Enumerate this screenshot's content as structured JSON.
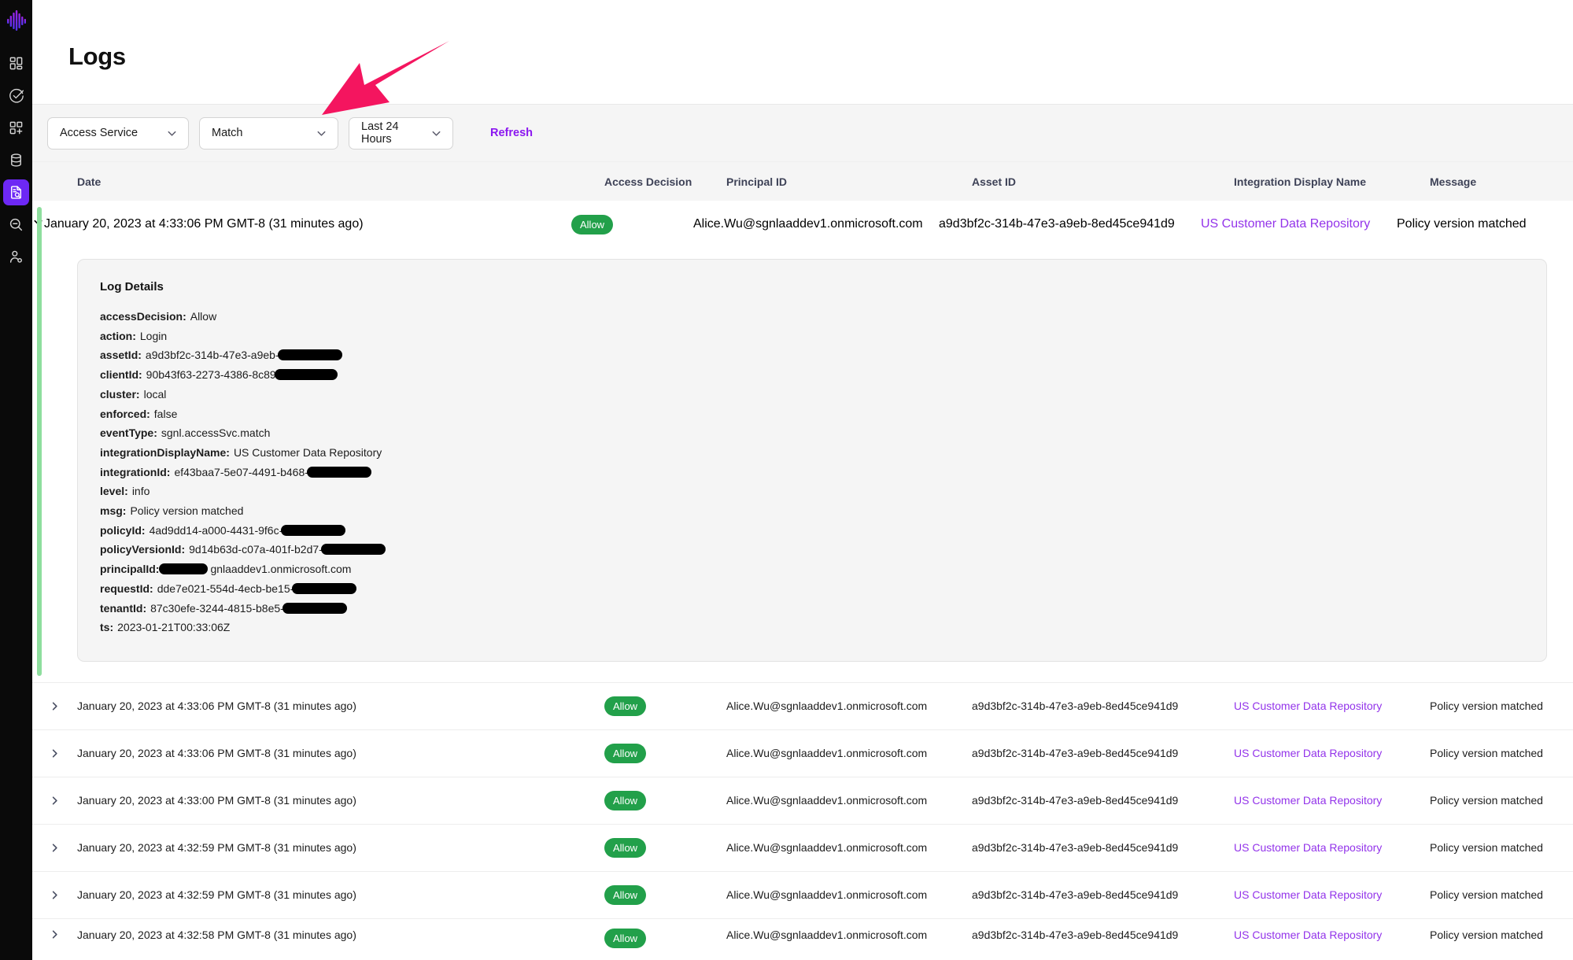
{
  "sidebar": {
    "logo_name": "waveform-logo",
    "items": [
      {
        "icon": "dashboard-grid-icon",
        "name": "sidebar-item-dashboard",
        "active": false
      },
      {
        "icon": "check-circle-icon",
        "name": "sidebar-item-policies",
        "active": false
      },
      {
        "icon": "add-grid-icon",
        "name": "sidebar-item-integrations",
        "active": false
      },
      {
        "icon": "database-icon",
        "name": "sidebar-item-datasources",
        "active": false
      },
      {
        "icon": "document-search-icon",
        "name": "sidebar-item-logs",
        "active": true
      },
      {
        "icon": "zoom-out-icon",
        "name": "sidebar-item-search",
        "active": false
      },
      {
        "icon": "user-settings-icon",
        "name": "sidebar-item-users",
        "active": false
      }
    ],
    "active_color": "#6d28f5"
  },
  "header": {
    "title": "Logs"
  },
  "filters": {
    "service": {
      "label": "Access Service"
    },
    "match": {
      "label": "Match"
    },
    "time_range": {
      "label": "Last 24 Hours"
    },
    "refresh_label": "Refresh",
    "refresh_color": "#8b16f0"
  },
  "table": {
    "columns": [
      {
        "key": "date",
        "label": "Date"
      },
      {
        "key": "access_decision",
        "label": "Access Decision"
      },
      {
        "key": "principal_id",
        "label": "Principal ID"
      },
      {
        "key": "asset_id",
        "label": "Asset ID"
      },
      {
        "key": "integration_display_name",
        "label": "Integration Display Name"
      },
      {
        "key": "message",
        "label": "Message"
      }
    ],
    "rows": [
      {
        "date": "January 20, 2023 at 4:33:06 PM GMT-8 (31 minutes ago)",
        "access_decision": "Allow",
        "principal_id": "Alice.Wu@sgnlaaddev1.onmicrosoft.com",
        "asset_id": "a9d3bf2c-314b-47e3-a9eb-8ed45ce941d9",
        "integration_display_name": "US Customer Data Repository",
        "message": "Policy version matched",
        "expanded": true
      },
      {
        "date": "January 20, 2023 at 4:33:06 PM GMT-8 (31 minutes ago)",
        "access_decision": "Allow",
        "principal_id": "Alice.Wu@sgnlaaddev1.onmicrosoft.com",
        "asset_id": "a9d3bf2c-314b-47e3-a9eb-8ed45ce941d9",
        "integration_display_name": "US Customer Data Repository",
        "message": "Policy version matched",
        "expanded": false
      },
      {
        "date": "January 20, 2023 at 4:33:06 PM GMT-8 (31 minutes ago)",
        "access_decision": "Allow",
        "principal_id": "Alice.Wu@sgnlaaddev1.onmicrosoft.com",
        "asset_id": "a9d3bf2c-314b-47e3-a9eb-8ed45ce941d9",
        "integration_display_name": "US Customer Data Repository",
        "message": "Policy version matched",
        "expanded": false
      },
      {
        "date": "January 20, 2023 at 4:33:00 PM GMT-8 (31 minutes ago)",
        "access_decision": "Allow",
        "principal_id": "Alice.Wu@sgnlaaddev1.onmicrosoft.com",
        "asset_id": "a9d3bf2c-314b-47e3-a9eb-8ed45ce941d9",
        "integration_display_name": "US Customer Data Repository",
        "message": "Policy version matched",
        "expanded": false
      },
      {
        "date": "January 20, 2023 at 4:32:59 PM GMT-8 (31 minutes ago)",
        "access_decision": "Allow",
        "principal_id": "Alice.Wu@sgnlaaddev1.onmicrosoft.com",
        "asset_id": "a9d3bf2c-314b-47e3-a9eb-8ed45ce941d9",
        "integration_display_name": "US Customer Data Repository",
        "message": "Policy version matched",
        "expanded": false
      },
      {
        "date": "January 20, 2023 at 4:32:59 PM GMT-8 (31 minutes ago)",
        "access_decision": "Allow",
        "principal_id": "Alice.Wu@sgnlaaddev1.onmicrosoft.com",
        "asset_id": "a9d3bf2c-314b-47e3-a9eb-8ed45ce941d9",
        "integration_display_name": "US Customer Data Repository",
        "message": "Policy version matched",
        "expanded": false
      },
      {
        "date": "January 20, 2023 at 4:32:58 PM GMT-8 (31 minutes ago)",
        "access_decision": "Allow",
        "principal_id": "Alice.Wu@sgnlaaddev1.onmicrosoft.com",
        "asset_id": "a9d3bf2c-314b-47e3-a9eb-8ed45ce941d9",
        "integration_display_name": "US Customer Data Repository",
        "message": "Policy version matched",
        "expanded": false
      }
    ],
    "badge_allow_color": "#22a04a",
    "integration_link_color": "#9333ea",
    "expanded_accent_color": "#8ede9e"
  },
  "log_details": {
    "title": "Log Details",
    "fields": [
      {
        "key": "accessDecision:",
        "value": "Allow",
        "redacted_width": 0
      },
      {
        "key": "action:",
        "value": "Login",
        "redacted_width": 0
      },
      {
        "key": "assetId:",
        "value": "a9d3bf2c-314b-47e3-a9eb-",
        "redacted_width": 82
      },
      {
        "key": "clientId:",
        "value": "90b43f63-2273-4386-8c89",
        "redacted_width": 80
      },
      {
        "key": "cluster:",
        "value": "local",
        "redacted_width": 0
      },
      {
        "key": "enforced:",
        "value": "false",
        "redacted_width": 0
      },
      {
        "key": "eventType:",
        "value": "sgnl.accessSvc.match",
        "redacted_width": 0
      },
      {
        "key": "integrationDisplayName:",
        "value": "US Customer Data Repository",
        "redacted_width": 0
      },
      {
        "key": "integrationId:",
        "value": "ef43baa7-5e07-4491-b468-",
        "redacted_width": 82
      },
      {
        "key": "level:",
        "value": "info",
        "redacted_width": 0
      },
      {
        "key": "msg:",
        "value": "Policy version matched",
        "redacted_width": 0
      },
      {
        "key": "policyId:",
        "value": "4ad9dd14-a000-4431-9f6c-",
        "redacted_width": 82
      },
      {
        "key": "policyVersionId:",
        "value": "9d14b63d-c07a-401f-b2d7-",
        "redacted_width": 82
      },
      {
        "key": "principalId:",
        "value": "gnlaaddev1.onmicrosoft.com",
        "redacted_width": 62,
        "redact_before": true
      },
      {
        "key": "requestId:",
        "value": "dde7e021-554d-4ecb-be15-",
        "redacted_width": 82
      },
      {
        "key": "tenantId:",
        "value": "87c30efe-3244-4815-b8e5-",
        "redacted_width": 82
      },
      {
        "key": "ts:",
        "value": "2023-01-21T00:33:06Z",
        "redacted_width": 0
      }
    ]
  },
  "annotation": {
    "arrow_name": "pink-pointer-arrow",
    "arrow_color": "#f4155f",
    "points_to": "Match"
  }
}
